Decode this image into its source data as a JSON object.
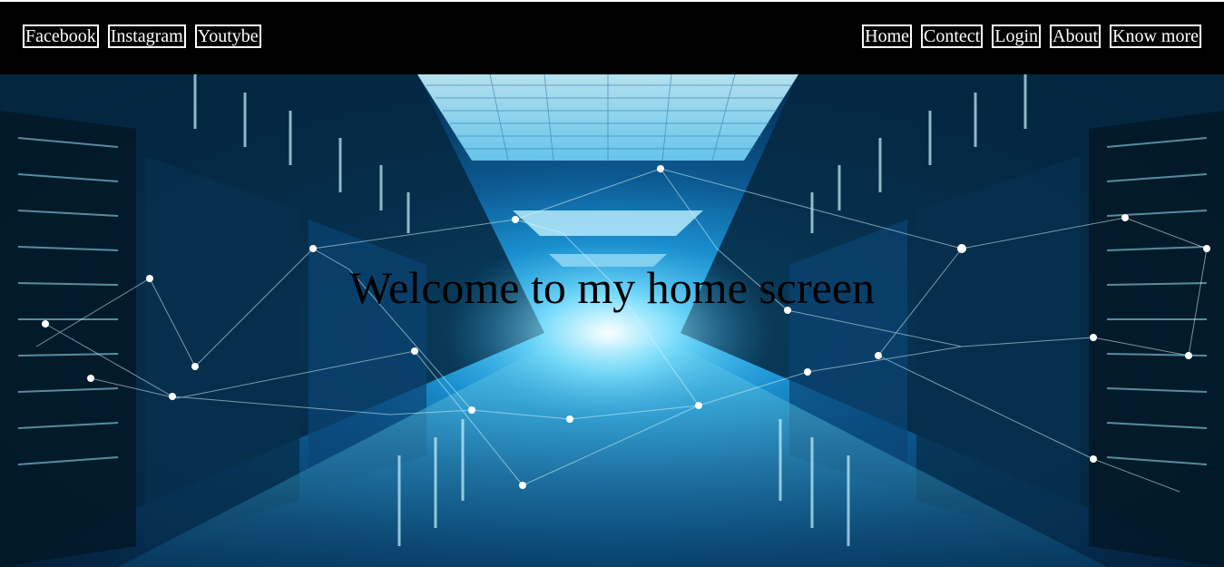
{
  "nav": {
    "left": [
      {
        "label": "Facebook"
      },
      {
        "label": "Instagram"
      },
      {
        "label": "Youtybe"
      }
    ],
    "right": [
      {
        "label": "Home"
      },
      {
        "label": "Contect"
      },
      {
        "label": "Login"
      },
      {
        "label": "About"
      },
      {
        "label": "Know more"
      }
    ]
  },
  "hero": {
    "title": "Welcome to my home screen",
    "background": "data-center-server-corridor-image"
  },
  "colors": {
    "topbar": "#000000",
    "nav_text": "#ffffff",
    "title_text": "#000000",
    "hero_accent": "#4ec8f4"
  }
}
